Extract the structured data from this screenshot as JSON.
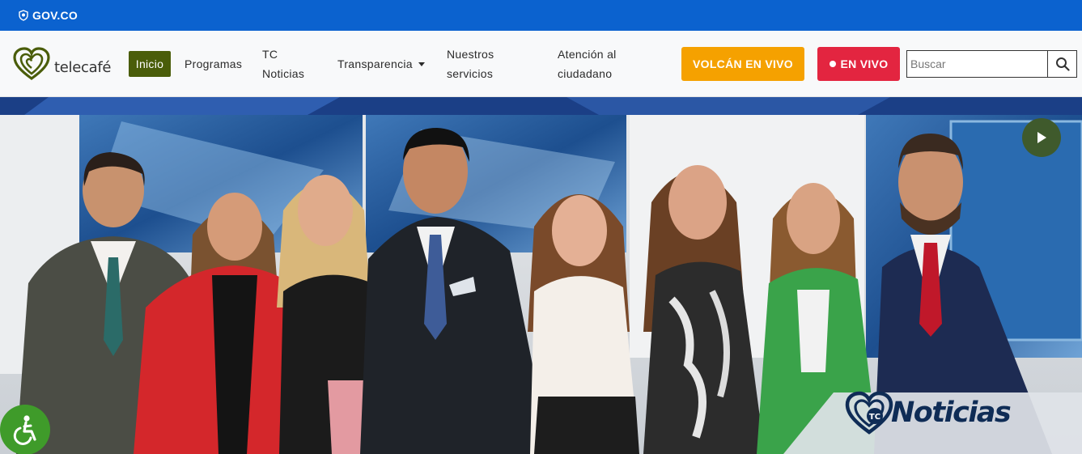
{
  "govbar": {
    "text": "GOV.CO"
  },
  "nav": {
    "logo_text": "telecafé",
    "items": [
      {
        "label": "Inicio",
        "active": true
      },
      {
        "label": "Programas"
      },
      {
        "label": "TC Noticias"
      },
      {
        "label": "Transparencia",
        "dropdown": true
      },
      {
        "label": "Nuestros servicios"
      },
      {
        "label": "Atención al ciudadano"
      }
    ],
    "volcan_button": "VOLCÁN EN VIVO",
    "live_button": "EN VIVO",
    "search_placeholder": "Buscar"
  },
  "hero": {
    "badge_text": "Noticias",
    "badge_prefix": "TC"
  },
  "colors": {
    "gov_blue": "#0b62cf",
    "active_green": "#4a5d0a",
    "volcan_orange": "#f5a100",
    "live_red": "#e32540",
    "play_green": "#3f5a2c",
    "accessibility_green": "#3f9b2a",
    "badge_navy": "#0f2c56"
  },
  "icons": {
    "gov": "shield-icon",
    "search": "search-icon",
    "play": "play-icon",
    "accessibility": "wheelchair-icon"
  }
}
